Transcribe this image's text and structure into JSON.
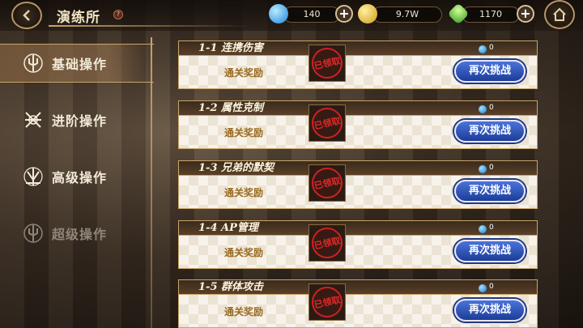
{
  "header": {
    "title": "演练所",
    "help_label": "?"
  },
  "resources": [
    {
      "name": "blue-gem",
      "value": "140",
      "color": "#2aa0e8"
    },
    {
      "name": "gold-coin",
      "value": "9.7W",
      "color": "#e8b830"
    },
    {
      "name": "green-crystal",
      "value": "1170",
      "color": "#58c838"
    }
  ],
  "plus_label": "+",
  "sidebar": {
    "items": [
      {
        "label": "基础操作",
        "state": "active"
      },
      {
        "label": "进阶操作",
        "state": "normal"
      },
      {
        "label": "高级操作",
        "state": "normal"
      },
      {
        "label": "超级操作",
        "state": "locked"
      }
    ]
  },
  "stages": [
    {
      "title": "1-1 连携伤害",
      "reward_label": "通关奖励",
      "stamp": "已领取",
      "gem_count": "0",
      "button": "再次挑战"
    },
    {
      "title": "1-2 属性克制",
      "reward_label": "通关奖励",
      "stamp": "已领取",
      "gem_count": "0",
      "button": "再次挑战"
    },
    {
      "title": "1-3 兄弟的默契",
      "reward_label": "通关奖励",
      "stamp": "已领取",
      "gem_count": "0",
      "button": "再次挑战"
    },
    {
      "title": "1-4 AP管理",
      "reward_label": "通关奖励",
      "stamp": "已领取",
      "gem_count": "0",
      "button": "再次挑战"
    },
    {
      "title": "1-5 群体攻击",
      "reward_label": "通关奖励",
      "stamp": "已领取",
      "gem_count": "0",
      "button": "再次挑战"
    }
  ]
}
